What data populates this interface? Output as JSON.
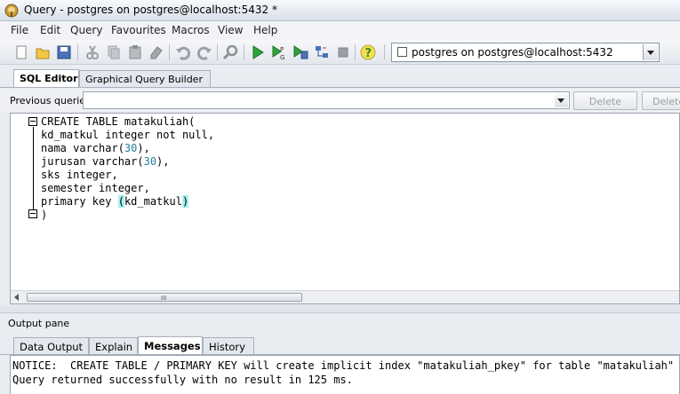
{
  "window": {
    "title": "Query - postgres on postgres@localhost:5432 *"
  },
  "menu": [
    "File",
    "Edit",
    "Query",
    "Favourites",
    "Macros",
    "View",
    "Help"
  ],
  "toolbar": {
    "connection": "postgres on postgres@localhost:5432",
    "icons": [
      "new-icon",
      "open-icon",
      "save-icon",
      "cut-icon",
      "copy-icon",
      "paste-icon",
      "clear-icon",
      "undo-icon",
      "redo-icon",
      "find-icon",
      "execute-icon",
      "execute-pgscript-icon",
      "execute-to-file-icon",
      "explain-icon",
      "stop-icon",
      "help-icon"
    ]
  },
  "editor_tabs": [
    "SQL Editor",
    "Graphical Query Builder"
  ],
  "previous_queries": {
    "label": "Previous queries",
    "delete": "Delete",
    "delete_all": "Delete All"
  },
  "code_lines": [
    [
      {
        "t": "CREATE TABLE matakuliah("
      }
    ],
    [
      {
        "t": "kd_matkul integer not null,"
      }
    ],
    [
      {
        "t": "nama varchar("
      },
      {
        "t": "30",
        "c": "num"
      },
      {
        "t": "),"
      }
    ],
    [
      {
        "t": "jurusan varchar("
      },
      {
        "t": "30",
        "c": "num"
      },
      {
        "t": "),"
      }
    ],
    [
      {
        "t": "sks integer,"
      }
    ],
    [
      {
        "t": "semester integer,"
      }
    ],
    [
      {
        "t": "primary key "
      },
      {
        "t": "(",
        "c": "hl"
      },
      {
        "t": "kd_matkul"
      },
      {
        "t": ")",
        "c": "hl"
      }
    ],
    [
      {
        "t": ")"
      }
    ]
  ],
  "scroll_grip": "III",
  "output": {
    "pane_label": "Output pane",
    "tabs": [
      "Data Output",
      "Explain",
      "Messages",
      "History"
    ],
    "active_tab": "Messages",
    "messages": [
      "NOTICE:  CREATE TABLE / PRIMARY KEY will create implicit index \"matakuliah_pkey\" for table \"matakuliah\"",
      "Query returned successfully with no result in 125 ms."
    ]
  },
  "colors": {
    "number": "#2a7f9e",
    "bracket_highlight": "#a9f0f2"
  }
}
